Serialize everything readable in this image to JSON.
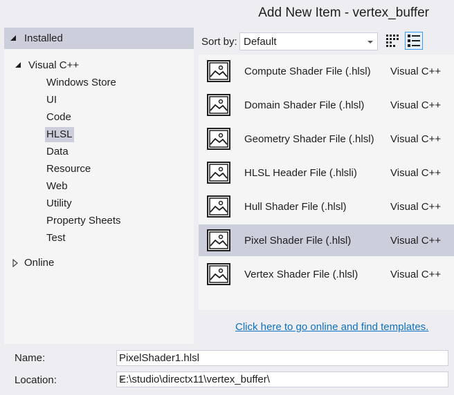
{
  "window": {
    "title": "Add New Item - vertex_buffer"
  },
  "tree": {
    "installed_label": "Installed",
    "visual_cpp_label": "Visual C++",
    "sub_items": [
      {
        "label": "Windows Store"
      },
      {
        "label": "UI"
      },
      {
        "label": "Code"
      },
      {
        "label": "HLSL"
      },
      {
        "label": "Data"
      },
      {
        "label": "Resource"
      },
      {
        "label": "Web"
      },
      {
        "label": "Utility"
      },
      {
        "label": "Property Sheets"
      },
      {
        "label": "Test"
      }
    ],
    "selected_sub_item": "HLSL",
    "online_label": "Online"
  },
  "toolbar": {
    "sort_label": "Sort by:",
    "sort_value": "Default"
  },
  "templates": [
    {
      "name": "Compute Shader File (.hlsl)",
      "language": "Visual C++"
    },
    {
      "name": "Domain Shader File (.hlsl)",
      "language": "Visual C++"
    },
    {
      "name": "Geometry Shader File (.hlsl)",
      "language": "Visual C++"
    },
    {
      "name": "HLSL Header File (.hlsli)",
      "language": "Visual C++"
    },
    {
      "name": "Hull Shader File (.hlsl)",
      "language": "Visual C++"
    },
    {
      "name": "Pixel Shader File (.hlsl)",
      "language": "Visual C++"
    },
    {
      "name": "Vertex Shader File (.hlsl)",
      "language": "Visual C++"
    }
  ],
  "selected_template": "Pixel Shader File (.hlsl)",
  "online_link": "Click here to go online and find templates.",
  "fields": {
    "name_label": "Name:",
    "name_value": "PixelShader1.hlsl",
    "location_label": "Location:",
    "location_value": "E:\\studio\\directx11\\vertex_buffer\\"
  },
  "colors": {
    "selection": "#cccedb",
    "link": "#0e70c0",
    "background": "#eeeef2"
  }
}
